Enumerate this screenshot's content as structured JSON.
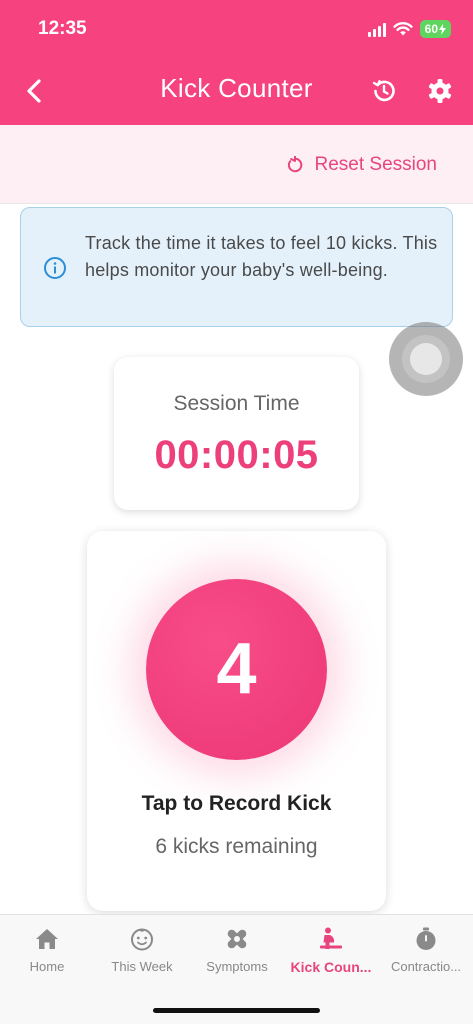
{
  "status_bar": {
    "time": "12:35",
    "battery": "60"
  },
  "header": {
    "title": "Kick Counter",
    "back_icon": "chevron-left-icon",
    "history_icon": "history-icon",
    "settings_icon": "gear-icon"
  },
  "toolbar": {
    "reset_label": "Reset Session",
    "reset_icon": "refresh-icon"
  },
  "info": {
    "icon": "info-icon",
    "text": "Track the time it takes to feel 10 kicks. This helps monitor your baby's well-being."
  },
  "session": {
    "label": "Session Time",
    "time": "00:00:05"
  },
  "kick": {
    "count": "4",
    "label": "Tap to Record Kick",
    "remaining": "6 kicks remaining"
  },
  "tabs": [
    {
      "label": "Home",
      "icon": "home-icon",
      "active": false
    },
    {
      "label": "This Week",
      "icon": "baby-face-icon",
      "active": false
    },
    {
      "label": "Symptoms",
      "icon": "bandage-icon",
      "active": false
    },
    {
      "label": "Kick Coun...",
      "icon": "pregnant-icon",
      "active": true
    },
    {
      "label": "Contractio...",
      "icon": "stopwatch-icon",
      "active": false
    }
  ],
  "colors": {
    "primary": "#f6427f",
    "accent": "#ec3f7b",
    "info_bg": "#e4f1fb",
    "info_border": "#a9cfe9",
    "subbar_bg": "#fdeff3"
  }
}
